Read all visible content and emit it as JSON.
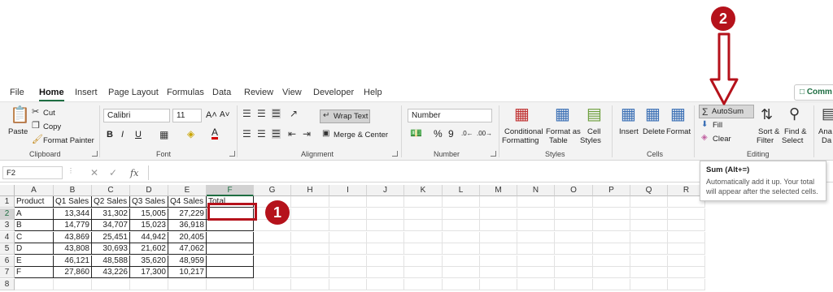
{
  "menu": {
    "tabs": [
      "File",
      "Home",
      "Insert",
      "Page Layout",
      "Formulas",
      "Data",
      "Review",
      "View",
      "Developer",
      "Help"
    ],
    "comments": "Comm"
  },
  "clipboard": {
    "paste": "Paste",
    "cut": "Cut",
    "copy": "Copy",
    "format_painter": "Format Painter",
    "label": "Clipboard"
  },
  "font": {
    "name": "Calibri",
    "size": "11",
    "bold": "B",
    "italic": "I",
    "underline": "U",
    "grow": "A˄",
    "shrink": "A˅",
    "color_letter": "A",
    "label": "Font"
  },
  "alignment": {
    "wrap_text": "Wrap Text",
    "merge_center": "Merge & Center",
    "label": "Alignment"
  },
  "number": {
    "format": "Number",
    "percent": "%",
    "comma": "9",
    "label": "Number"
  },
  "styles": {
    "conditional": [
      "Conditional",
      "Formatting"
    ],
    "format_table": [
      "Format as",
      "Table"
    ],
    "cell_styles": [
      "Cell",
      "Styles"
    ],
    "label": "Styles"
  },
  "cells": {
    "insert": "Insert",
    "delete": "Delete",
    "format": "Format",
    "label": "Cells"
  },
  "editing": {
    "autosum": "AutoSum",
    "fill": "Fill",
    "clear": "Clear",
    "sort_filter": [
      "Sort &",
      "Filter"
    ],
    "find_select": [
      "Find &",
      "Select"
    ],
    "label": "Editing"
  },
  "analyze": [
    "Ana",
    "Da"
  ],
  "formula_bar": {
    "name_box": "F2",
    "fx": "fx",
    "value": ""
  },
  "columns": [
    "A",
    "B",
    "C",
    "D",
    "E",
    "F",
    "G",
    "H",
    "I",
    "J",
    "K",
    "L",
    "M",
    "N",
    "O",
    "P",
    "Q",
    "R"
  ],
  "rows": [
    "1",
    "2",
    "3",
    "4",
    "5",
    "6",
    "7",
    "8"
  ],
  "table": {
    "headers": [
      "Product",
      "Q1 Sales",
      "Q2 Sales",
      "Q3 Sales",
      "Q4 Sales",
      "Total"
    ],
    "rows": [
      [
        "A",
        "13,344",
        "31,302",
        "15,005",
        "27,229"
      ],
      [
        "B",
        "14,779",
        "34,707",
        "15,023",
        "36,918"
      ],
      [
        "C",
        "43,869",
        "25,451",
        "44,942",
        "20,405"
      ],
      [
        "D",
        "43,808",
        "30,693",
        "21,602",
        "47,062"
      ],
      [
        "E",
        "46,121",
        "48,588",
        "35,620",
        "48,959"
      ],
      [
        "F",
        "27,860",
        "43,226",
        "17,300",
        "10,217"
      ]
    ]
  },
  "tooltip": {
    "title": "Sum (Alt+=)",
    "body": "Automatically add it up. Your total will appear after the selected cells."
  },
  "callouts": {
    "one": "1",
    "two": "2"
  },
  "colors": {
    "accent_green": "#1e6e42",
    "callout_red": "#b5121b"
  }
}
